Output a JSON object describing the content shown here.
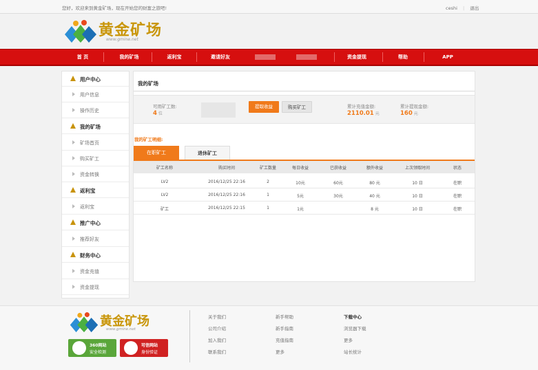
{
  "topbar": {
    "welcome": "您好，欢迎来到黄金矿场，现在开始您的财富之旅吧!",
    "user": "ceshi",
    "logout": "退出"
  },
  "brand": {
    "name": "黄金矿场",
    "url": "www.gmine.net"
  },
  "nav": {
    "items": [
      "首 页",
      "我的矿场",
      "返利宝",
      "邀请好友",
      "资金提现",
      "帮助",
      "APP"
    ]
  },
  "sidebar": {
    "sections": [
      {
        "title": "用户中心",
        "items": [
          "用户信息",
          "操作历史"
        ]
      },
      {
        "title": "我的矿场",
        "items": [
          "矿场首页",
          "购买矿工",
          "资金转换"
        ]
      },
      {
        "title": "返利宝",
        "items": [
          "返利宝"
        ]
      },
      {
        "title": "推广中心",
        "items": [
          "推荐好友"
        ]
      },
      {
        "title": "财务中心",
        "items": [
          "资金充值",
          "资金提现"
        ]
      }
    ]
  },
  "main": {
    "title": "我的矿场",
    "available_label": "可用矿工数:",
    "available_value": "4",
    "available_unit": "位",
    "btn_collect": "提取收益",
    "btn_buy": "购买矿工",
    "recharge_label": "累计充值金额:",
    "recharge_value": "2110.01",
    "recharge_unit": "元",
    "withdraw_label": "累计提现金额:",
    "withdraw_value": "160",
    "withdraw_unit": "元",
    "detail_label": "我的矿工明细:",
    "tab_active": "在职矿工",
    "tab_inactive": "退休矿工"
  },
  "table": {
    "headers": [
      "矿工名称",
      "购买时间",
      "矿工数量",
      "每日收益",
      "已获收益",
      "额外收益",
      "上次领取时间",
      "状态"
    ],
    "rows": [
      [
        "LV2",
        "2016/12/25 22:16",
        "2",
        "10元",
        "60元",
        "80 元",
        "10 日",
        "在职"
      ],
      [
        "LV2",
        "2016/12/25 22:16",
        "1",
        "5元",
        "30元",
        "40 元",
        "10 日",
        "在职"
      ],
      [
        "矿工",
        "2016/12/25 22:15",
        "1",
        "1元",
        "",
        "8 元",
        "10 日",
        "在职"
      ]
    ]
  },
  "footer": {
    "col1": [
      "关于我们",
      "公司介绍",
      "加入我们",
      "联系我们"
    ],
    "col2": [
      "新手帮助",
      "新手指南",
      "充值指南",
      "更多"
    ],
    "col3": [
      "下载中心",
      "浏览器下载",
      "更多",
      "站长统计"
    ],
    "badge1_line1": "360网站",
    "badge1_line2": "安全检测",
    "badge2_line1": "可信网站",
    "badge2_line2": "身份验证"
  },
  "colors": {
    "nav_red": "#d60f0f",
    "accent_orange": "#f07a1a",
    "brand_gold": "#c9960a"
  }
}
